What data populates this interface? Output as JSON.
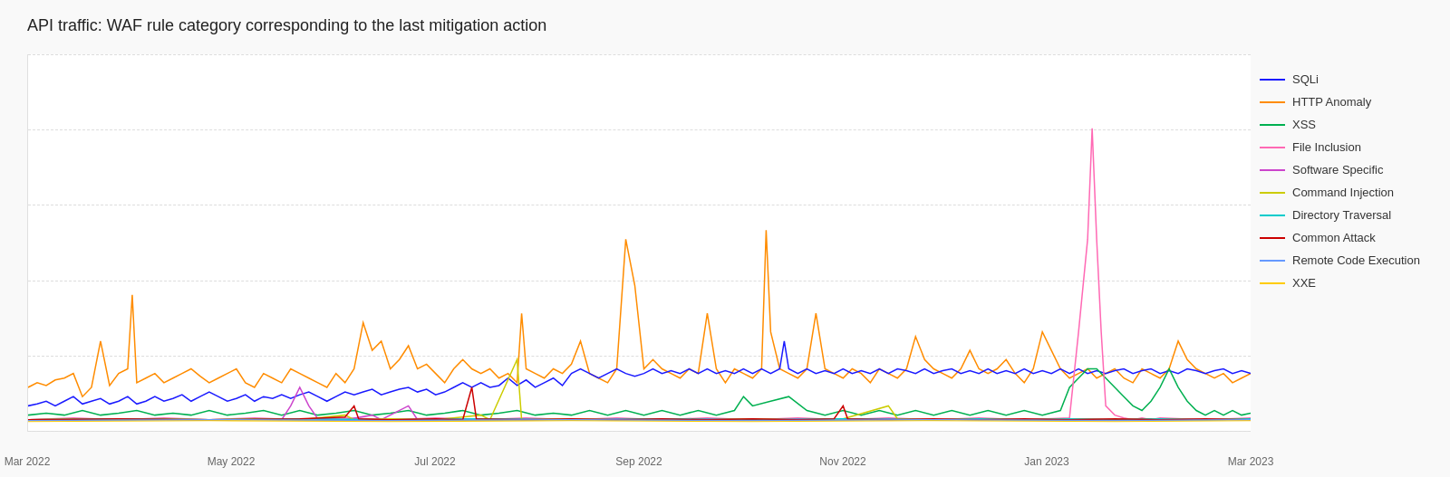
{
  "title": "API traffic: WAF rule category corresponding to the last mitigation action",
  "legend": {
    "items": [
      {
        "label": "SQLi",
        "color": "#1a1aff"
      },
      {
        "label": "HTTP Anomaly",
        "color": "#ff8c00"
      },
      {
        "label": "XSS",
        "color": "#00b050"
      },
      {
        "label": "File Inclusion",
        "color": "#ff69b4"
      },
      {
        "label": "Software Specific",
        "color": "#cc44cc"
      },
      {
        "label": "Command Injection",
        "color": "#cccc00"
      },
      {
        "label": "Directory Traversal",
        "color": "#00cccc"
      },
      {
        "label": "Common Attack",
        "color": "#cc0000"
      },
      {
        "label": "Remote Code Execution",
        "color": "#6699ff"
      },
      {
        "label": "XXE",
        "color": "#ffcc00"
      }
    ]
  },
  "xAxis": {
    "labels": [
      "Mar 2022",
      "May 2022",
      "Jul 2022",
      "Sep 2022",
      "Nov 2022",
      "Jan 2023",
      "Mar 2023"
    ]
  },
  "gridLines": [
    0.2,
    0.4,
    0.6,
    0.8,
    1.0
  ]
}
